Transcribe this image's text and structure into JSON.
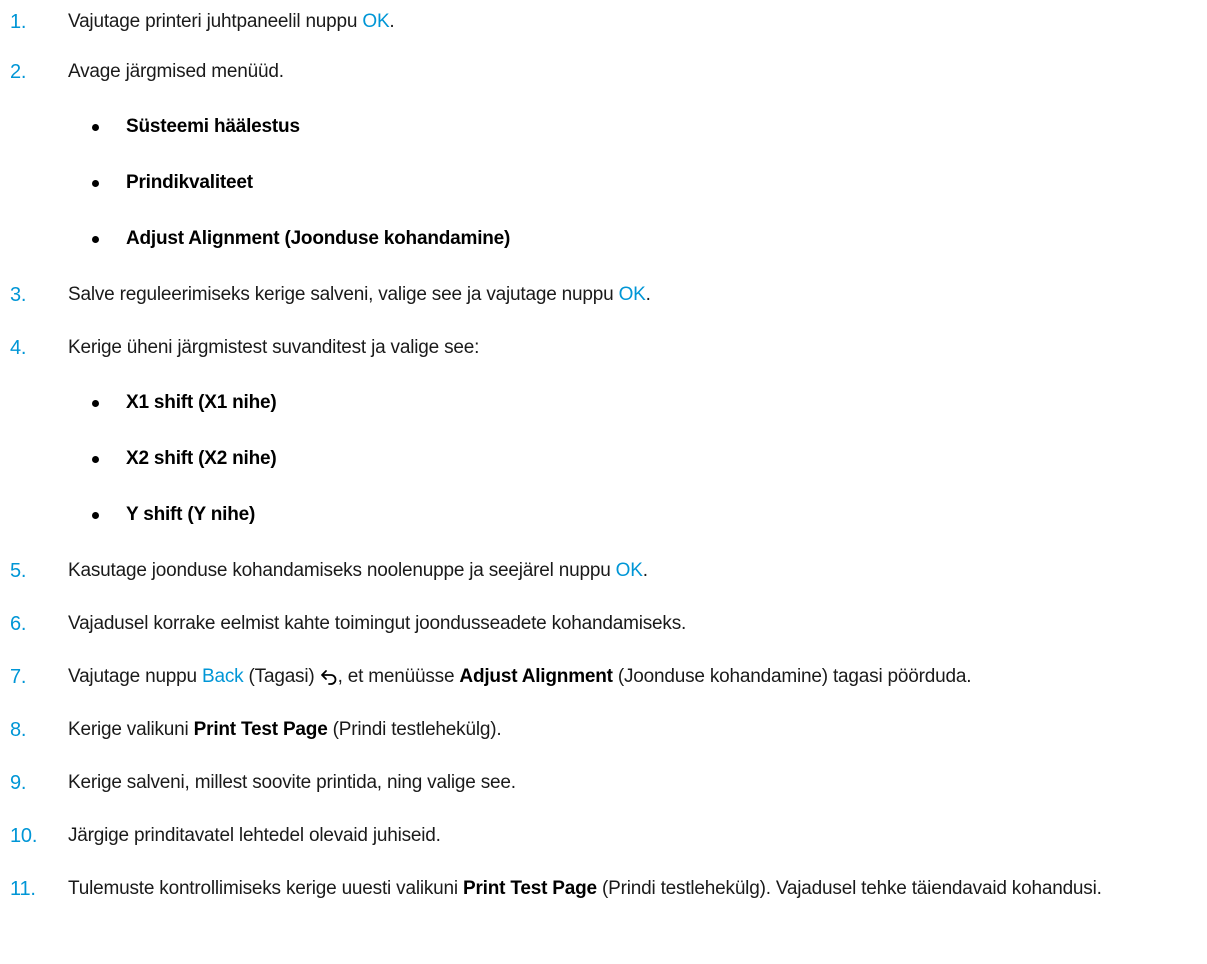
{
  "steps": [
    {
      "num": "1.",
      "pre": "Vajutage printeri juhtpaneelil nuppu ",
      "link": "OK",
      "post": "."
    },
    {
      "num": "2.",
      "text": "Avage järgmised menüüd."
    },
    {
      "num": "3.",
      "pre": "Salve reguleerimiseks kerige salveni, valige see ja vajutage nuppu ",
      "link": "OK",
      "post": "."
    },
    {
      "num": "4.",
      "text": "Kerige üheni järgmistest suvanditest ja valige see:"
    },
    {
      "num": "5.",
      "pre": "Kasutage joonduse kohandamiseks noolenuppe ja seejärel nuppu ",
      "link": "OK",
      "post": "."
    },
    {
      "num": "6.",
      "text": "Vajadusel korrake eelmist kahte toimingut joondusseadete kohandamiseks."
    },
    {
      "num": "7.",
      "pre": "Vajutage nuppu ",
      "link": "Back",
      "mid": " (Tagasi) ",
      "mid2": ", et menüüsse ",
      "strong": "Adjust Alignment",
      "post": " (Joonduse kohandamine) tagasi pöörduda."
    },
    {
      "num": "8.",
      "pre": "Kerige valikuni ",
      "strong": "Print Test Page",
      "post": " (Prindi testlehekülg)."
    },
    {
      "num": "9.",
      "text": "Kerige salveni, millest soovite printida, ning valige see."
    },
    {
      "num": "10.",
      "text": "Järgige prinditavatel lehtedel olevaid juhiseid."
    },
    {
      "num": "11.",
      "pre": "Tulemuste kontrollimiseks kerige uuesti valikuni ",
      "strong": "Print Test Page",
      "post": " (Prindi testlehekülg). Vajadusel tehke täiendavaid kohandusi."
    }
  ],
  "menus": [
    "Süsteemi häälestus",
    "Prindikvaliteet",
    "Adjust Alignment (Joonduse kohandamine)"
  ],
  "shift_options": [
    "X1 shift (X1 nihe)",
    "X2 shift (X2 nihe)",
    "Y shift (Y nihe)"
  ],
  "icons": {
    "back": "back-arrow-icon"
  },
  "colors": {
    "accent": "#0096d6",
    "text": "#1a1a1a"
  }
}
